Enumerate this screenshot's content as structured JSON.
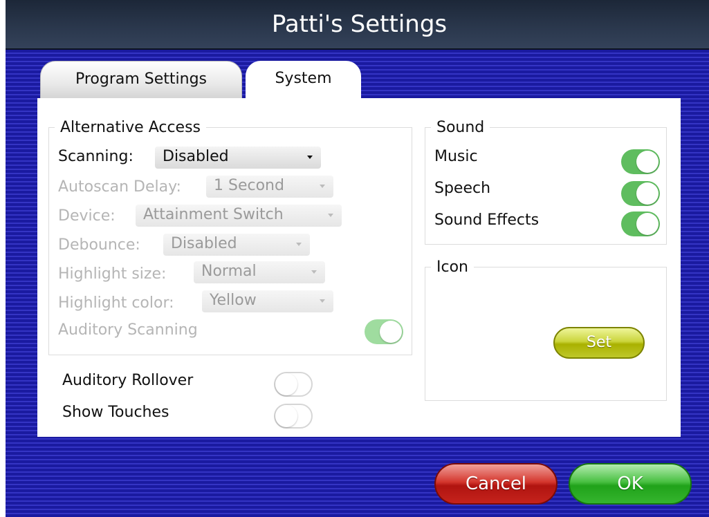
{
  "window": {
    "title": "Patti's Settings"
  },
  "tabs": {
    "program_settings": "Program Settings",
    "system": "System",
    "active": "System"
  },
  "alternative_access": {
    "legend": "Alternative Access",
    "scanning": {
      "label": "Scanning:",
      "value": "Disabled"
    },
    "autoscan_delay": {
      "label": "Autoscan Delay:",
      "value": "1 Second"
    },
    "device": {
      "label": "Device:",
      "value": "Attainment Switch"
    },
    "debounce": {
      "label": "Debounce:",
      "value": "Disabled"
    },
    "highlight_size": {
      "label": "Highlight size:",
      "value": "Normal"
    },
    "highlight_color": {
      "label": "Highlight color:",
      "value": "Yellow"
    },
    "auditory_scanning": {
      "label": "Auditory Scanning",
      "on": true
    }
  },
  "general": {
    "auditory_rollover": {
      "label": "Auditory Rollover",
      "on": false
    },
    "show_touches": {
      "label": "Show Touches",
      "on": false
    }
  },
  "sound": {
    "legend": "Sound",
    "music": {
      "label": "Music",
      "on": true
    },
    "speech": {
      "label": "Speech",
      "on": true
    },
    "sound_effects": {
      "label": "Sound Effects",
      "on": true
    }
  },
  "icon": {
    "legend": "Icon",
    "set_label": "Set"
  },
  "buttons": {
    "cancel": "Cancel",
    "ok": "OK"
  },
  "colors": {
    "background_blue": "#1a1aa0",
    "toggle_on": "#5fbd5f",
    "cancel_red": "#c5231c",
    "ok_green": "#2ab023",
    "set_olive": "#b7c01a"
  },
  "icons": [
    "chevron-down-icon"
  ]
}
